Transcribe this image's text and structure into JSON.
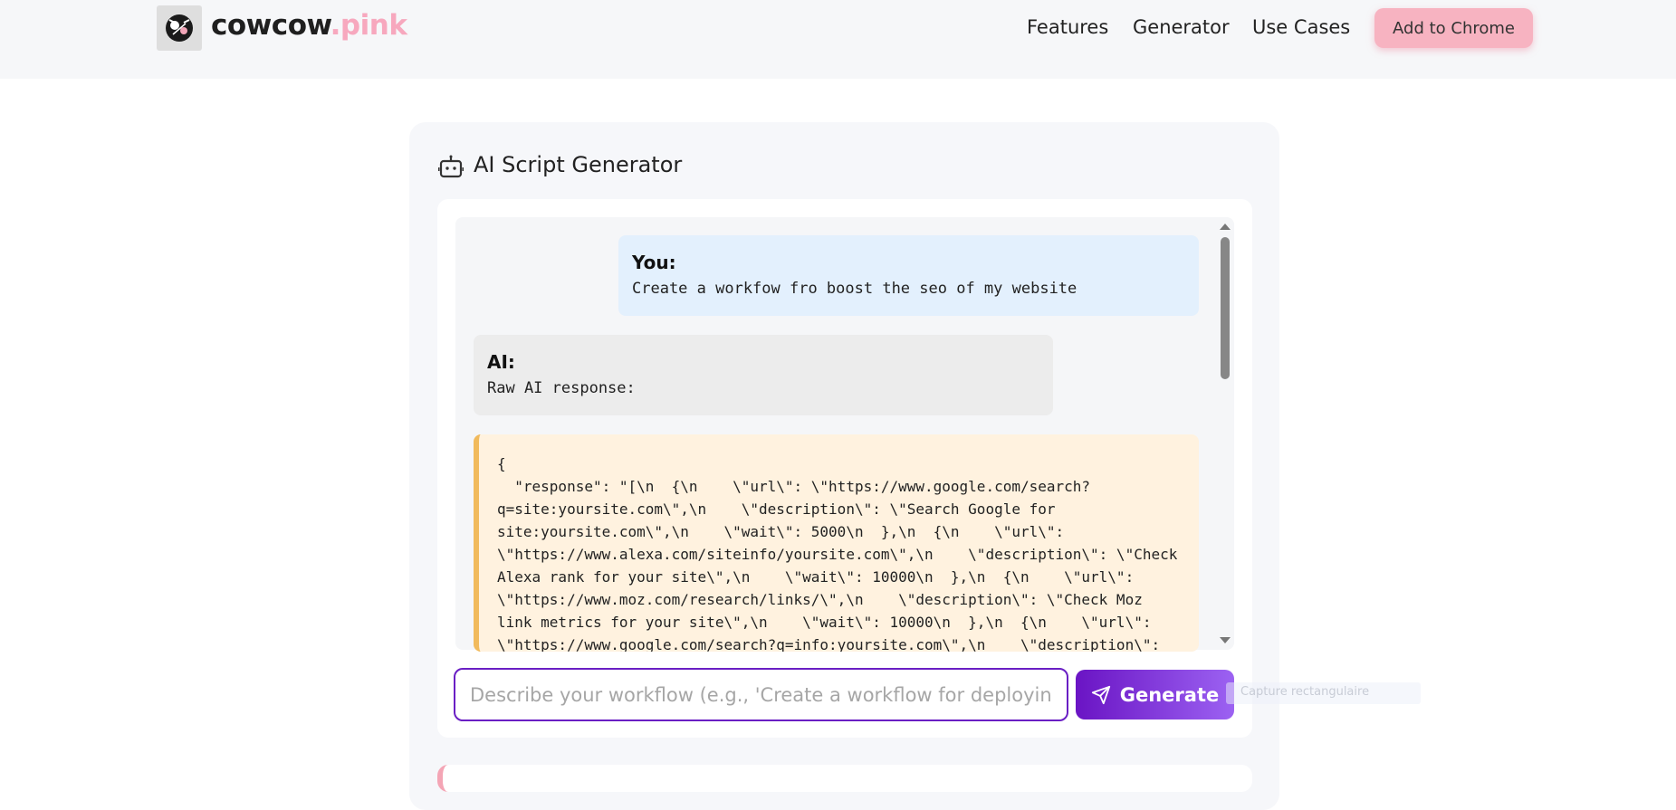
{
  "brand": {
    "name": "cowcow",
    "tld": ".pink"
  },
  "nav": {
    "features": "Features",
    "generator": "Generator",
    "use_cases": "Use Cases",
    "cta": "Add to Chrome"
  },
  "card": {
    "title": "AI Script Generator"
  },
  "chat": {
    "user_label": "You:",
    "user_message": "Create a workfow fro boost the seo of my website",
    "ai_label": "AI:",
    "ai_message": "Raw AI response:",
    "code_lines": [
      "{",
      "  \"response\": \"[\\n  {\\n    \\\"url\\\": \\\"https://www.google.com/search?",
      "q=site:yoursite.com\\\",\\n    \\\"description\\\": \\\"Search Google for",
      "site:yoursite.com\\\",\\n    \\\"wait\\\": 5000\\n  },\\n  {\\n    \\\"url\\\":",
      "\\\"https://www.alexa.com/siteinfo/yoursite.com\\\",\\n    \\\"description\\\": \\\"Check",
      "Alexa rank for your site\\\",\\n    \\\"wait\\\": 10000\\n  },\\n  {\\n    \\\"url\\\":",
      "\\\"https://www.moz.com/research/links/\\\",\\n    \\\"description\\\": \\\"Check Moz",
      "link metrics for your site\\\",\\n    \\\"wait\\\": 10000\\n  },\\n  {\\n    \\\"url\\\":",
      "\\\"https://www.google.com/search?q=info:yoursite.com\\\",\\n    \\\"description\\\":"
    ]
  },
  "composer": {
    "placeholder": "Describe your workflow (e.g., 'Create a workflow for deploying a V",
    "generate_label": "Generate"
  },
  "overlay": {
    "text": "Capture rectangulaire"
  },
  "colors": {
    "accent": "#6a14c4",
    "brand_pink": "#f7a8be",
    "cta": "#f7b3c1",
    "code_border": "#f1ba5c"
  }
}
